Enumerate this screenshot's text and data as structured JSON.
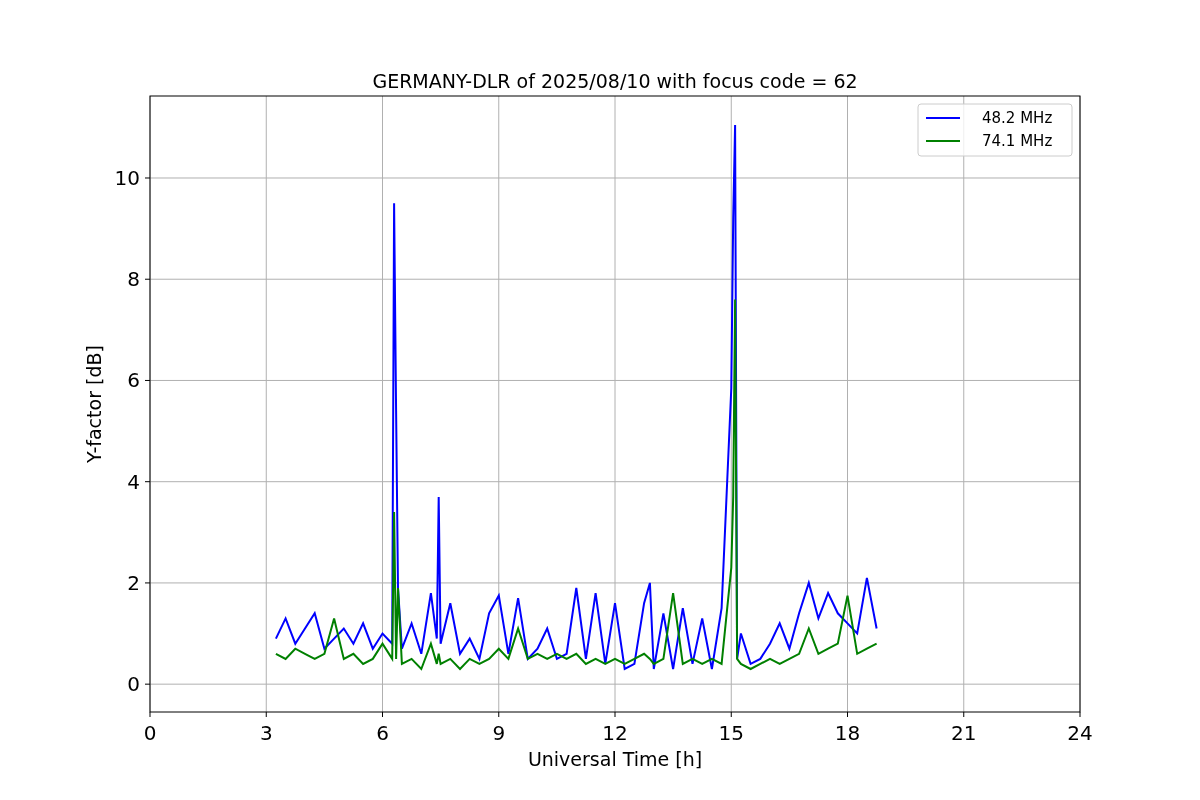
{
  "figure": {
    "chart_data": {
      "type": "line",
      "title": "GERMANY-DLR of 2025/08/10 with focus code = 62",
      "xlabel": "Universal Time [h]",
      "ylabel": "Y-factor [dB]",
      "x": [
        3.25,
        3.5,
        3.75,
        4.0,
        4.25,
        4.5,
        4.75,
        5.0,
        5.25,
        5.5,
        5.75,
        6.0,
        6.25,
        6.3,
        6.35,
        6.4,
        6.5,
        6.75,
        7.0,
        7.25,
        7.4,
        7.45,
        7.5,
        7.75,
        8.0,
        8.25,
        8.5,
        8.75,
        9.0,
        9.25,
        9.5,
        9.75,
        10.0,
        10.25,
        10.5,
        10.75,
        11.0,
        11.25,
        11.5,
        11.75,
        12.0,
        12.25,
        12.5,
        12.75,
        12.9,
        13.0,
        13.25,
        13.5,
        13.75,
        14.0,
        14.25,
        14.5,
        14.75,
        15.0,
        15.05,
        15.1,
        15.15,
        15.25,
        15.5,
        15.75,
        16.0,
        16.25,
        16.5,
        16.75,
        17.0,
        17.25,
        17.5,
        17.75,
        18.0,
        18.25,
        18.5,
        18.75
      ],
      "series": [
        {
          "name": "48.2 MHz",
          "color": "#0000ff",
          "values": [
            0.9,
            1.3,
            0.8,
            1.1,
            1.4,
            0.7,
            0.9,
            1.1,
            0.8,
            1.2,
            0.7,
            1.0,
            0.8,
            9.5,
            5.4,
            1.9,
            0.7,
            1.2,
            0.6,
            1.8,
            0.9,
            3.7,
            0.8,
            1.6,
            0.6,
            0.9,
            0.5,
            1.4,
            1.75,
            0.6,
            1.7,
            0.5,
            0.7,
            1.1,
            0.5,
            0.6,
            1.9,
            0.5,
            1.8,
            0.4,
            1.6,
            0.3,
            0.4,
            1.6,
            2.0,
            0.3,
            1.4,
            0.3,
            1.5,
            0.4,
            1.3,
            0.3,
            1.5,
            5.85,
            9.2,
            11.05,
            0.5,
            1.0,
            0.4,
            0.5,
            0.8,
            1.2,
            0.7,
            1.4,
            2.0,
            1.3,
            1.8,
            1.4,
            1.2,
            1.0,
            2.1,
            1.1
          ]
        },
        {
          "name": "74.1 MHz",
          "color": "#008000",
          "values": [
            0.6,
            0.5,
            0.7,
            0.6,
            0.5,
            0.6,
            1.3,
            0.5,
            0.6,
            0.4,
            0.5,
            0.8,
            0.5,
            3.4,
            0.5,
            1.9,
            0.4,
            0.5,
            0.3,
            0.8,
            0.4,
            0.6,
            0.4,
            0.5,
            0.3,
            0.5,
            0.4,
            0.5,
            0.7,
            0.5,
            1.1,
            0.5,
            0.6,
            0.5,
            0.6,
            0.5,
            0.6,
            0.4,
            0.5,
            0.4,
            0.5,
            0.4,
            0.5,
            0.6,
            0.5,
            0.4,
            0.5,
            1.8,
            0.4,
            0.5,
            0.4,
            0.5,
            0.4,
            2.3,
            3.7,
            7.6,
            0.5,
            0.4,
            0.3,
            0.4,
            0.5,
            0.4,
            0.5,
            0.6,
            1.1,
            0.6,
            0.7,
            0.8,
            1.75,
            0.6,
            0.7,
            0.8
          ]
        }
      ],
      "xlim": [
        0,
        24
      ],
      "ylim": [
        -0.55,
        11.62
      ],
      "xticks": [
        0,
        3,
        6,
        9,
        12,
        15,
        18,
        21,
        24
      ],
      "yticks": [
        0,
        2,
        4,
        6,
        8,
        10
      ],
      "grid": true,
      "legend": true
    }
  }
}
